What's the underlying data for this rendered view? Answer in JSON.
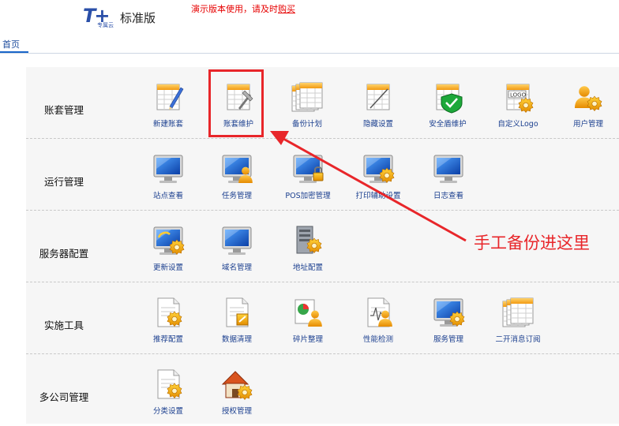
{
  "header": {
    "logo_mark": "T+",
    "logo_sub": "专属云",
    "logo_text": "标准版",
    "notice_prefix": "演示版本使用，请及时",
    "notice_link": "购买"
  },
  "tabs": [
    {
      "label": "首页"
    }
  ],
  "rows": [
    {
      "label": "账套管理",
      "items": [
        {
          "label": "新建账套",
          "icon": "ledger-pencil-icon"
        },
        {
          "label": "账套维护",
          "icon": "ledger-tools-icon"
        },
        {
          "label": "备份计划",
          "icon": "stacked-ledgers-icon"
        },
        {
          "label": "隐藏设置",
          "icon": "ledger-slash-icon"
        },
        {
          "label": "安全盾维护",
          "icon": "shield-check-icon"
        },
        {
          "label": "自定义Logo",
          "icon": "logo-gear-icon"
        },
        {
          "label": "用户管理",
          "icon": "user-gear-icon"
        }
      ]
    },
    {
      "label": "运行管理",
      "items": [
        {
          "label": "站点查看",
          "icon": "monitor-icon"
        },
        {
          "label": "任务管理",
          "icon": "monitor-user-icon"
        },
        {
          "label": "POS加密管理",
          "icon": "monitor-lock-icon"
        },
        {
          "label": "打印辅助设置",
          "icon": "monitor-gear-icon"
        },
        {
          "label": "日志查看",
          "icon": "monitor-document-icon"
        }
      ]
    },
    {
      "label": "服务器配置",
      "items": [
        {
          "label": "更新设置",
          "icon": "monitor-update-gear-icon"
        },
        {
          "label": "域名管理",
          "icon": "monitor-icon"
        },
        {
          "label": "地址配置",
          "icon": "server-gear-icon"
        }
      ]
    },
    {
      "label": "实施工具",
      "items": [
        {
          "label": "推荐配置",
          "icon": "document-gear-icon"
        },
        {
          "label": "数据清理",
          "icon": "document-edit-icon"
        },
        {
          "label": "碎片整理",
          "icon": "pie-user-icon"
        },
        {
          "label": "性能检测",
          "icon": "chart-user-icon"
        },
        {
          "label": "服务管理",
          "icon": "monitor-gear-icon"
        },
        {
          "label": "二开消息订阅",
          "icon": "stacked-ledgers-icon"
        }
      ]
    },
    {
      "label": "多公司管理",
      "items": [
        {
          "label": "分类设置",
          "icon": "document-gear-icon"
        },
        {
          "label": "授权管理",
          "icon": "house-gear-icon"
        }
      ]
    }
  ],
  "annotation": {
    "text": "手工备份进这里"
  },
  "colors": {
    "accent": "#1b66c9",
    "highlight": "#e8262a",
    "notice": "#e60000",
    "label": "#1b3f8f"
  }
}
